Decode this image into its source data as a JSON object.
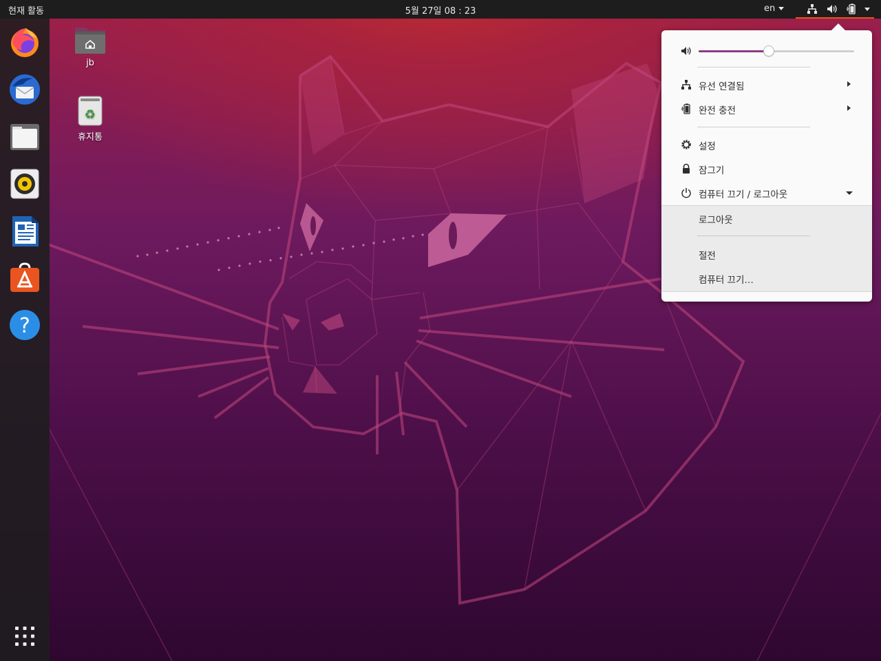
{
  "topbar": {
    "activities": "현재 활동",
    "clock": "5월 27일  08 : 23",
    "language": "en"
  },
  "desktop": {
    "icons": [
      {
        "label": "jb",
        "icon": "home-folder-icon"
      },
      {
        "label": "휴지통",
        "icon": "trash-icon"
      }
    ]
  },
  "dock": {
    "items": [
      {
        "name": "firefox",
        "icon": "firefox-icon"
      },
      {
        "name": "thunderbird",
        "icon": "thunderbird-icon"
      },
      {
        "name": "files",
        "icon": "files-icon"
      },
      {
        "name": "rhythmbox",
        "icon": "rhythmbox-icon"
      },
      {
        "name": "libreoffice-writer",
        "icon": "writer-icon"
      },
      {
        "name": "ubuntu-software",
        "icon": "software-icon"
      },
      {
        "name": "help",
        "icon": "help-icon"
      }
    ],
    "show_apps": "grid-icon"
  },
  "menu": {
    "volume": 0.45,
    "wired": "유선 연결됨",
    "battery": "완전 충전",
    "settings": "설정",
    "lock": "잠그기",
    "power": "컴퓨터 끄기 / 로그아웃",
    "logout": "로그아웃",
    "suspend": "절전",
    "power_off": "컴퓨터 끄기…"
  },
  "colors": {
    "accent": "#e95420",
    "slider": "#8b3b86"
  }
}
